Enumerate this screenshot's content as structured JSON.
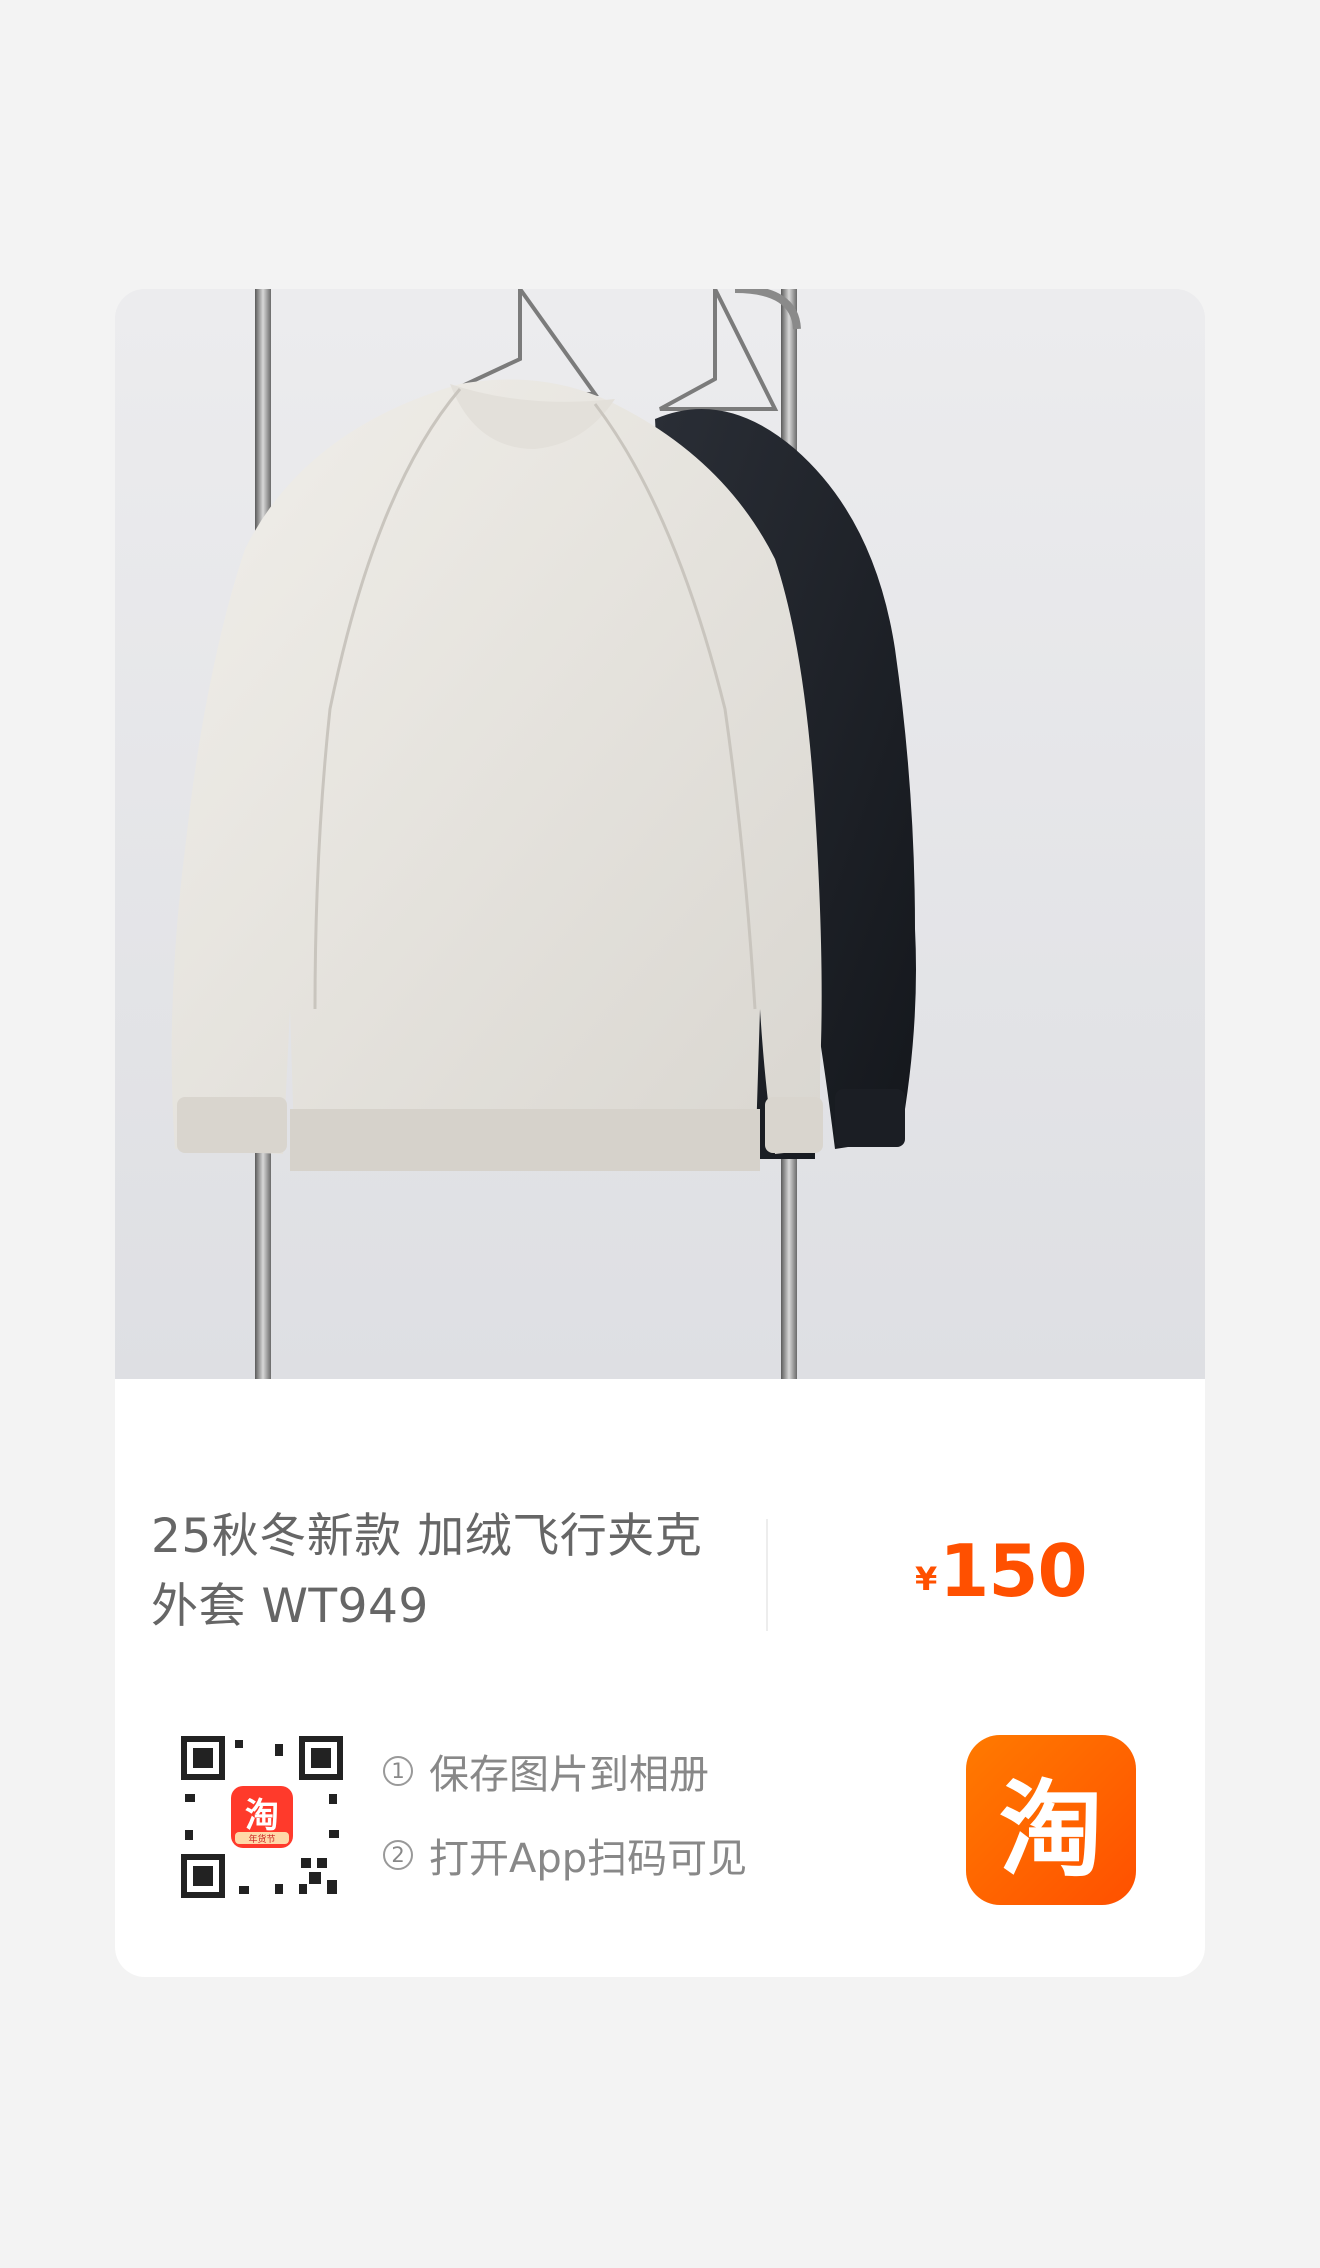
{
  "product": {
    "title_line1": "25秋冬新款 加绒飞行夹克",
    "title_line2": "外套 WT949",
    "currency": "¥",
    "price": "150",
    "image_icon": "product-photo-icon"
  },
  "share": {
    "step1_num": "1",
    "step1_text": "保存图片到相册",
    "step2_num": "2",
    "step2_text": "打开App扫码可见",
    "qr_icon": "qr-code-icon",
    "qr_badge_char": "淘",
    "qr_badge_sub": "年货节"
  },
  "brand": {
    "logo_char": "淘",
    "logo_icon": "taobao-logo-icon"
  },
  "colors": {
    "price": "#ff5000",
    "logo": "#ff5000",
    "background": "#f3f3f3",
    "card": "#ffffff"
  }
}
